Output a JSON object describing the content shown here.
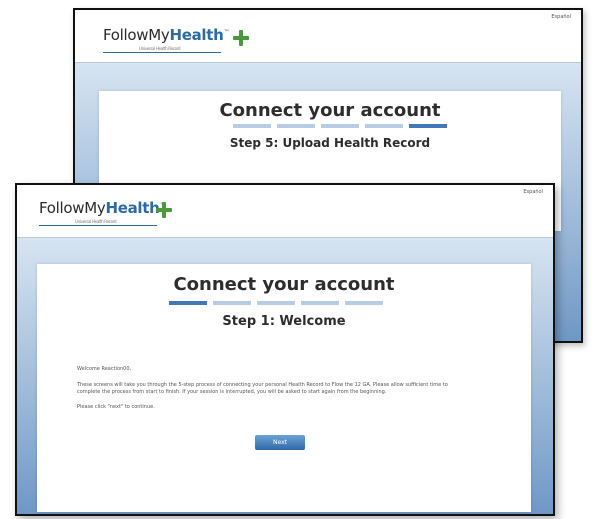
{
  "back_window": {
    "language_link": "Español",
    "logo": {
      "part1": "FollowMy",
      "part2": "Health",
      "tm": "™",
      "tagline": "Universal Health Record",
      "icon": "green-plus-icon"
    },
    "panel": {
      "title": "Connect your account",
      "step_title": "Step 5: Upload Health Record",
      "progress": {
        "total_steps": 5,
        "active_step": 5
      }
    }
  },
  "front_window": {
    "language_link": "Español",
    "logo": {
      "part1": "FollowMy",
      "part2": "Health",
      "tm": "™",
      "tagline": "Universal Health Record",
      "icon": "green-plus-icon"
    },
    "panel": {
      "title": "Connect your account",
      "step_title": "Step 1: Welcome",
      "progress": {
        "total_steps": 5,
        "active_step": 1
      },
      "welcome_line": "Welcome Reaction00,",
      "paragraph": "These screens will take you through the 5-step process of connecting your personal Health Record to Flow the 12 GA. Please allow sufficient time to complete the process from start to finish. If your session is interrupted, you will be asked to start again from the beginning.",
      "instruction": "Please click \"next\" to continue.",
      "next_button": "Next"
    }
  },
  "colors": {
    "brand_blue": "#2c6aa6",
    "plus_green": "#4a9a3c",
    "progress_active": "#3f79b7",
    "progress_inactive": "#b8cde3",
    "background_gradient_top": "#d7e4f1",
    "background_gradient_bottom": "#6f97c6"
  }
}
